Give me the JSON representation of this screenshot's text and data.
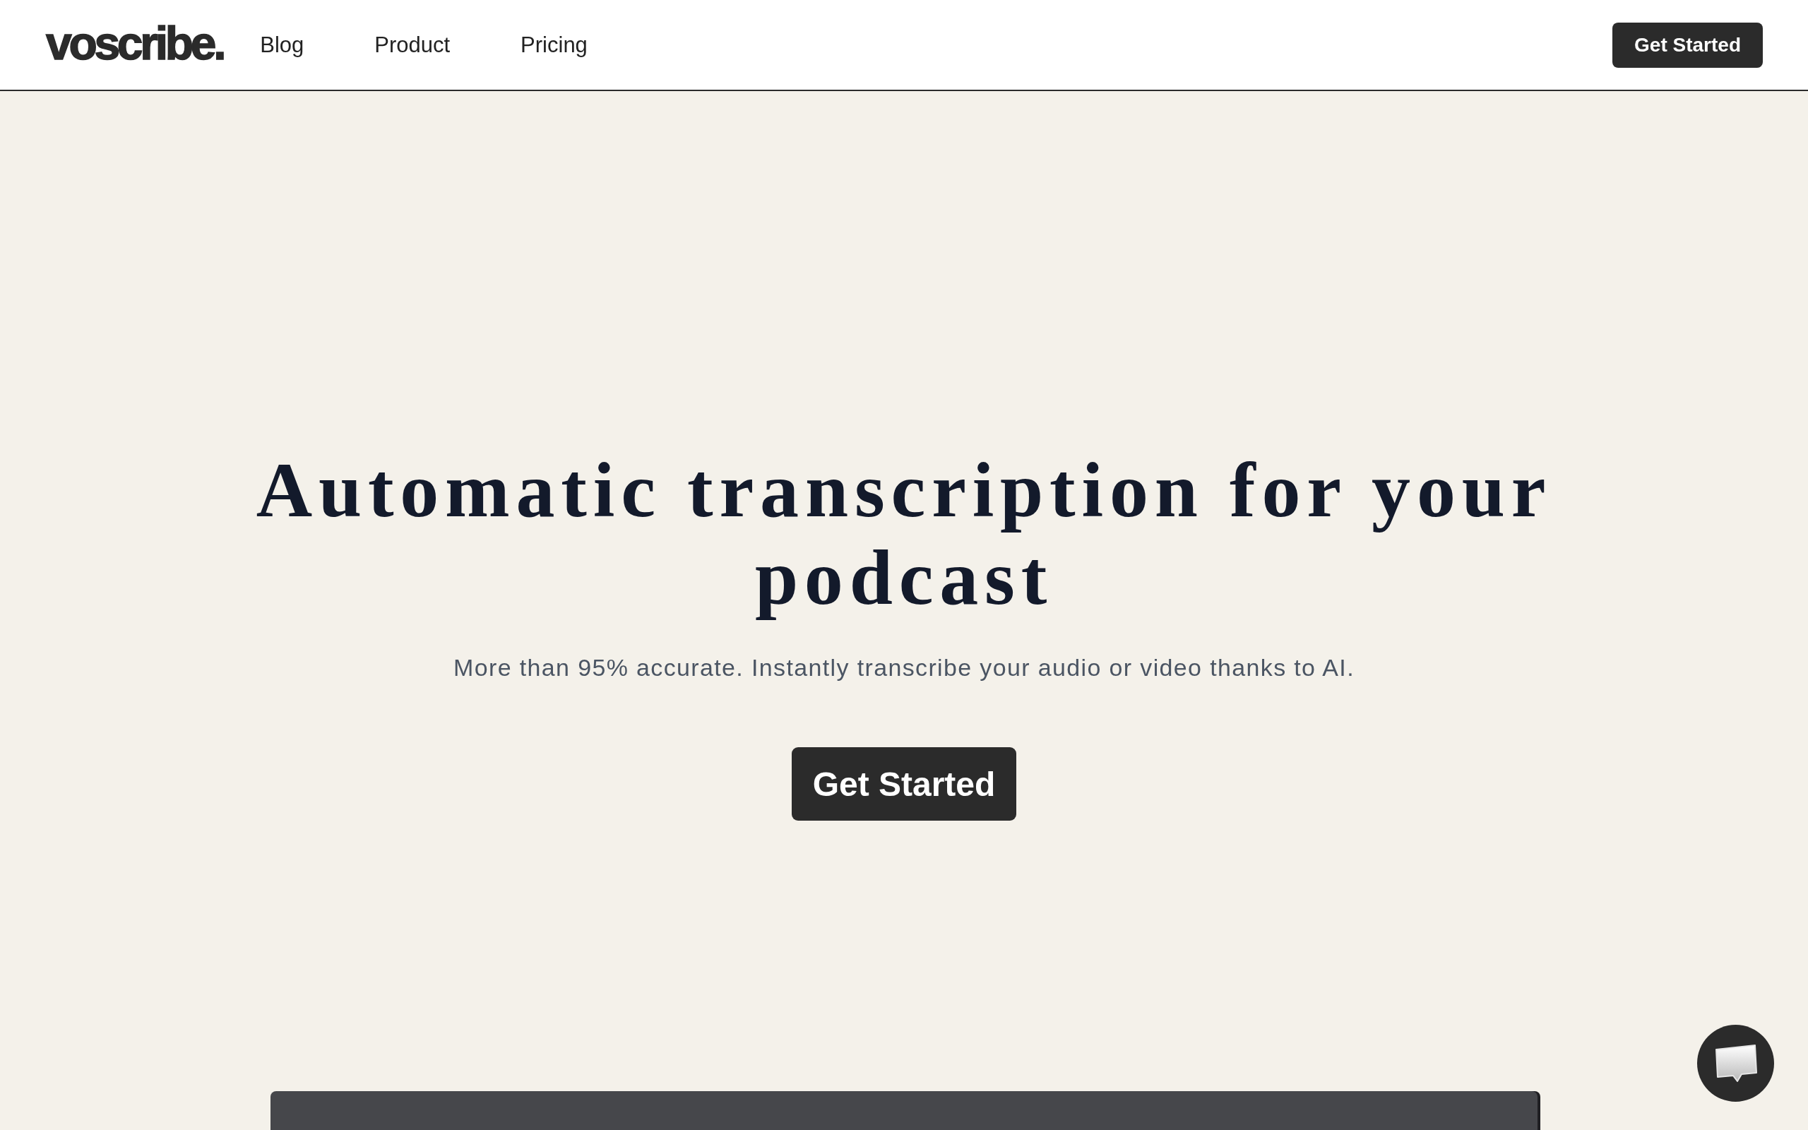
{
  "header": {
    "logo": "voscribe.",
    "nav": [
      "Blog",
      "Product",
      "Pricing"
    ],
    "cta": "Get Started"
  },
  "hero": {
    "title": "Automatic transcription for your podcast",
    "subtitle": "More than 95% accurate. Instantly transcribe your audio or video thanks to AI.",
    "cta": "Get Started"
  }
}
